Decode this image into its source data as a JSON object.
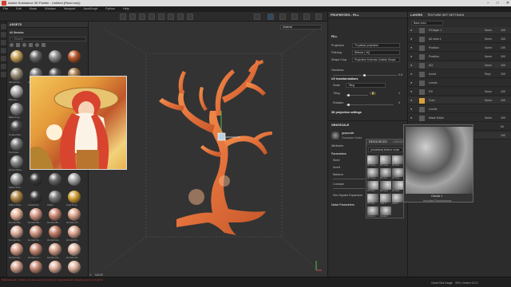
{
  "app": {
    "title": "Adobe Substance 3D Painter - Untitled (Read only)",
    "win_min": "–",
    "win_max": "□",
    "win_close": "✕"
  },
  "menu": [
    "File",
    "Edit",
    "Mode",
    "Window",
    "Viewport",
    "JavaScript",
    "Python",
    "Help"
  ],
  "assets": {
    "title": "ASSETS",
    "all_libraries": "All libraries",
    "search_placeholder": "Search",
    "items": [
      "",
      "",
      "",
      "",
      "Aluminium...",
      "Aluminium...",
      "Artificial Le...",
      "Autumn Lea...",
      "Bitterss...",
      "",
      "",
      "",
      "Baked Lig...",
      "",
      "",
      "",
      "Coated Me...",
      "",
      "",
      "",
      "Concrete...",
      "",
      "",
      "",
      "Denim Rive...",
      "",
      "",
      "",
      "Fabric Knit...",
      "",
      "",
      "",
      "Fabric Soft...",
      "Footprints",
      "Glitter",
      "Gold Pure",
      "Human Ba...",
      "Human Be...",
      "Human Bu...",
      "Human Ch...",
      "Human Ey...",
      "Human Fe...",
      "Human He...",
      "Human Fo...",
      "Human Ey...",
      "Human Le...",
      "Human Pa...",
      "Human Ne...",
      "",
      "",
      "",
      ""
    ]
  },
  "viewport": {
    "dropdown": "Material",
    "axis_label": "MASE",
    "coord": "X"
  },
  "properties": {
    "title": "PROPERTIES - FILL",
    "fill_section": "FILL",
    "projection_label": "Projection",
    "projection_value": "Tri-planar projection",
    "filtering_label": "Filtering",
    "filtering_value": "Bilinear | HQ",
    "shape_crop_label": "Shape Crop",
    "shape_crop_value": "Projection Extends Outside Shape",
    "hardness_label": "Hardness",
    "hardness_value": "0.5",
    "uv_section": "UV transformations",
    "scale_label": "Scale",
    "scale_value": "Tiling",
    "tiling_label": "Tiling",
    "tiling_value": "1",
    "rotation_label": "Rotation",
    "rotation_value": "0",
    "projection_settings": "3D projection settings",
    "grayscale_section": "GRAYSCALE",
    "grayscale_name": "grayscale",
    "grayscale_sub": "Gaussian Noise",
    "attributes": "Attributes",
    "parameters": "Parameters",
    "seed": "Seed",
    "invert": "Invert",
    "balance": "Balance",
    "contrast": "Contrast",
    "non_square": "Non Square Expansion",
    "noise_params": "Noise Parameters"
  },
  "resources": {
    "title": "RESOURCES",
    "tab2": "LIBRARY",
    "search": "procedural,texture noise",
    "thumbs": [
      "3D Noise",
      "3D Noise",
      "3D Nois...",
      "3D Noise",
      "3D Nois...",
      "3D Nois...",
      "3D Nois...",
      "3D Noise",
      "3D Nois...",
      "3D Nois...",
      "Cells 3",
      "Cells 4",
      "Clouds 1",
      "Clouds 2"
    ]
  },
  "preview": {
    "name": "Clouds 1",
    "sub": "Includes Randomness"
  },
  "layers": {
    "tab1": "LAYERS",
    "tab2": "TEXTURE SET SETTINGS",
    "dropdown": "Base color",
    "rows": [
      {
        "name": "Fill layer 1",
        "mode": "Norm",
        "op": "100"
      },
      {
        "name": "All rules 1",
        "mode": "Norm",
        "op": "100"
      },
      {
        "name": "Position",
        "mode": "Norm",
        "op": "100"
      },
      {
        "name": "Position",
        "mode": "Norm",
        "op": "100"
      },
      {
        "name": "AO",
        "mode": "Norm",
        "op": "100"
      },
      {
        "name": "Invert",
        "mode": "Repl",
        "op": "100"
      },
      {
        "name": "Levels",
        "mode": "",
        "op": ""
      },
      {
        "name": "Fill",
        "mode": "Norm",
        "op": "100"
      },
      {
        "name": "Curv",
        "mode": "Norm",
        "op": "100"
      },
      {
        "name": "Levels",
        "mode": "",
        "op": ""
      },
      {
        "name": "Mask Editor",
        "mode": "Norm",
        "op": "100"
      },
      {
        "name": "Fill",
        "mode": "",
        "op": "64"
      },
      {
        "name": "Fill",
        "mode": "",
        "op": "100"
      }
    ]
  },
  "status": {
    "left": "Material need / contain out some source correct text map selected in already used to normal list",
    "right_label": "Cache Disk Usage:",
    "right_value": "33% | Version: 8.3.0"
  },
  "colors": {
    "accent": "#d1402f",
    "tree": "#e2703a",
    "panel": "#2c2c2c"
  }
}
